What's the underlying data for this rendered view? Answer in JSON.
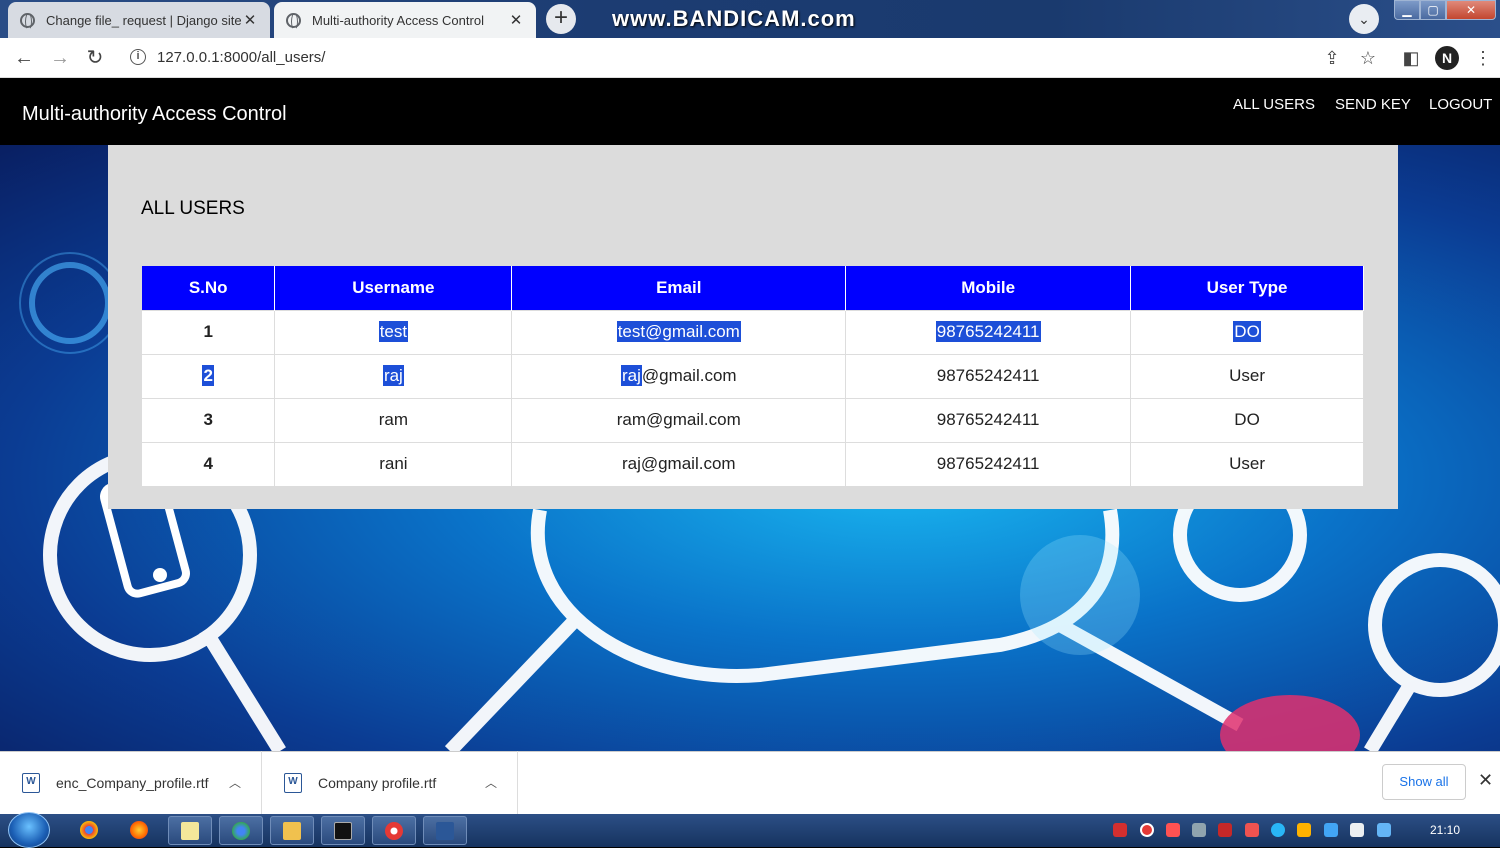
{
  "browser": {
    "tabs": [
      {
        "label": "Change file_ request | Django site",
        "active": false
      },
      {
        "label": "Multi-authority Access Control",
        "active": true
      }
    ],
    "new_tab": "+",
    "watermark": "www.BANDICAM.com",
    "url": "127.0.0.1:8000/all_users/"
  },
  "app": {
    "brand": "Multi-authority Access Control",
    "nav": [
      "ALL USERS",
      "SEND KEY",
      "LOGOUT"
    ],
    "heading": "ALL USERS"
  },
  "table": {
    "headers": [
      "S.No",
      "Username",
      "Email",
      "Mobile",
      "User Type"
    ],
    "rows": [
      {
        "sno": "1",
        "username": "test",
        "email": "test@gmail.com",
        "mobile": "98765242411",
        "type": "DO"
      },
      {
        "sno": "2",
        "username": "raj",
        "email_sel": "raj",
        "email_rest": "@gmail.com",
        "mobile": "98765242411",
        "type": "User"
      },
      {
        "sno": "3",
        "username": "ram",
        "email": "ram@gmail.com",
        "mobile": "98765242411",
        "type": "DO"
      },
      {
        "sno": "4",
        "username": "rani",
        "email": "raj@gmail.com",
        "mobile": "98765242411",
        "type": "User"
      }
    ]
  },
  "downloads": {
    "items": [
      "enc_Company_profile.rtf",
      "Company profile.rtf"
    ],
    "show_all": "Show all"
  },
  "taskbar": {
    "clock": "21:10"
  },
  "colors": {
    "table_header": "#0000ff",
    "selection": "#1d4fd8",
    "nav_bg": "#000000",
    "card_bg": "#dcdcdc"
  }
}
